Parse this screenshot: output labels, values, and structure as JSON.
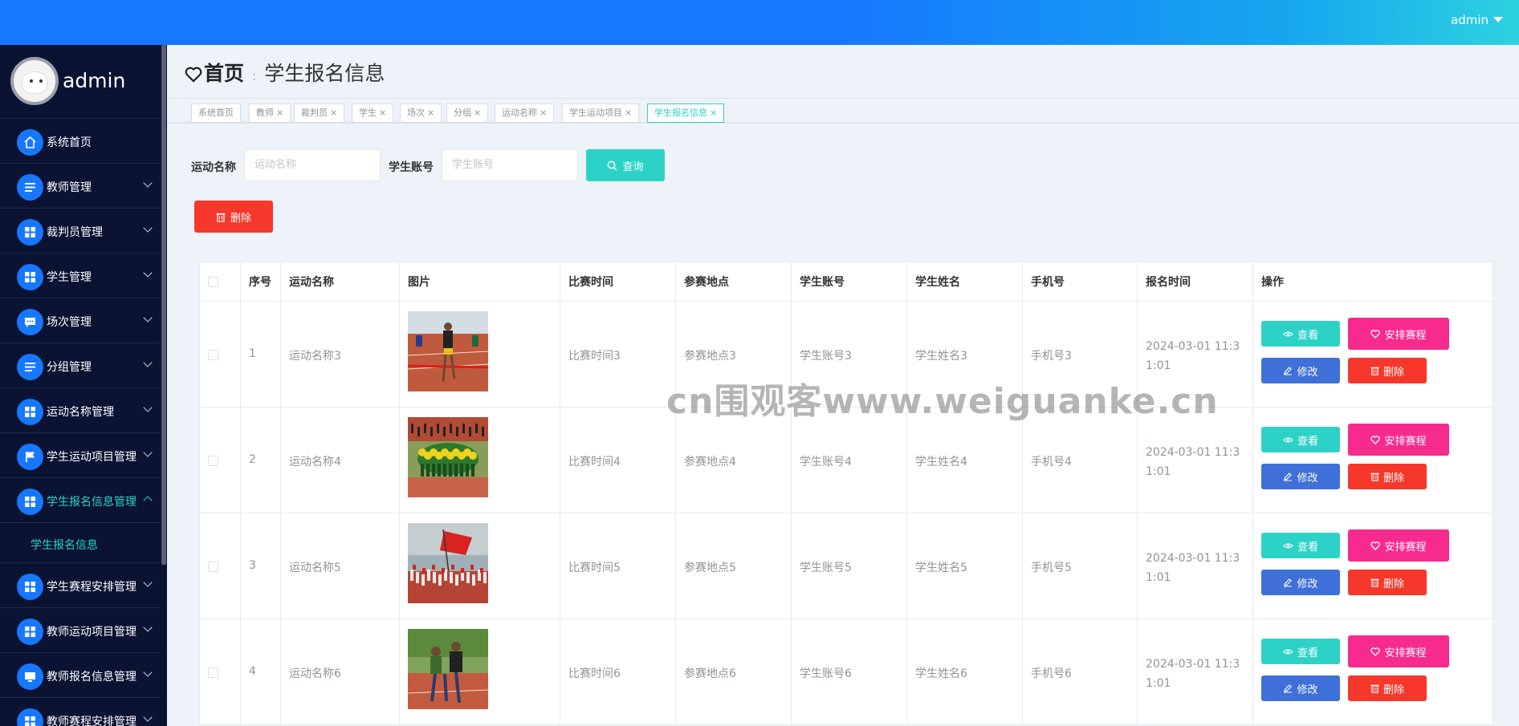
{
  "header": {
    "user": "admin"
  },
  "sidebar": {
    "profile_name": "admin",
    "items": [
      {
        "label": "系统首页",
        "icon": "home-icon",
        "has_chevron": false
      },
      {
        "label": "教师管理",
        "icon": "list-icon",
        "has_chevron": true
      },
      {
        "label": "裁判员管理",
        "icon": "grid-icon",
        "has_chevron": true
      },
      {
        "label": "学生管理",
        "icon": "grid-icon",
        "has_chevron": true
      },
      {
        "label": "场次管理",
        "icon": "chat-icon",
        "has_chevron": true
      },
      {
        "label": "分组管理",
        "icon": "list-icon",
        "has_chevron": true
      },
      {
        "label": "运动名称管理",
        "icon": "grid-icon",
        "has_chevron": true
      },
      {
        "label": "学生运动项目管理",
        "icon": "flag-icon",
        "has_chevron": true
      },
      {
        "label": "学生报名信息管理",
        "icon": "grid-icon",
        "has_chevron": true,
        "active": true
      },
      {
        "label": "学生赛程安排管理",
        "icon": "grid-icon",
        "has_chevron": true
      },
      {
        "label": "教师运动项目管理",
        "icon": "grid-icon",
        "has_chevron": true
      },
      {
        "label": "教师报名信息管理",
        "icon": "monitor-icon",
        "has_chevron": true
      },
      {
        "label": "教师赛程安排管理",
        "icon": "grid-icon",
        "has_chevron": true
      }
    ],
    "submenu_label": "学生报名信息"
  },
  "breadcrumb": {
    "home": "首页",
    "current": "学生报名信息"
  },
  "tabs": [
    {
      "label": "系统首页",
      "closable": false
    },
    {
      "label": "教师",
      "closable": true
    },
    {
      "label": "裁判员",
      "closable": true
    },
    {
      "label": "学生",
      "closable": true
    },
    {
      "label": "场次",
      "closable": true
    },
    {
      "label": "分组",
      "closable": true
    },
    {
      "label": "运动名称",
      "closable": true
    },
    {
      "label": "学生运动项目",
      "closable": true
    },
    {
      "label": "学生报名信息",
      "closable": true,
      "active": true
    }
  ],
  "search": {
    "sport_label": "运动名称",
    "sport_placeholder": "运动名称",
    "account_label": "学生账号",
    "account_placeholder": "学生账号",
    "query_button": "查询"
  },
  "actions": {
    "delete_button": "删除"
  },
  "table": {
    "headers": [
      "序号",
      "运动名称",
      "图片",
      "比赛时间",
      "参赛地点",
      "学生账号",
      "学生姓名",
      "手机号",
      "报名时间",
      "操作"
    ],
    "rows": [
      {
        "index": "1",
        "sport": "运动名称3",
        "time": "比赛时间3",
        "place": "参赛地点3",
        "account": "学生账号3",
        "name": "学生姓名3",
        "phone": "手机号3",
        "signup": "2024-03-01 11:31:01",
        "photo": "running-finish-photo"
      },
      {
        "index": "2",
        "sport": "运动名称4",
        "time": "比赛时间4",
        "place": "参赛地点4",
        "account": "学生账号4",
        "name": "学生姓名4",
        "phone": "手机号4",
        "signup": "2024-03-01 11:31:01",
        "photo": "parade-formation-photo"
      },
      {
        "index": "3",
        "sport": "运动名称5",
        "time": "比赛时间5",
        "place": "参赛地点5",
        "account": "学生账号5",
        "name": "学生姓名5",
        "phone": "手机号5",
        "signup": "2024-03-01 11:31:01",
        "photo": "flag-parade-photo"
      },
      {
        "index": "4",
        "sport": "运动名称6",
        "time": "比赛时间6",
        "place": "参赛地点6",
        "account": "学生账号6",
        "name": "学生姓名6",
        "phone": "手机号6",
        "signup": "2024-03-01 11:31:01",
        "photo": "three-legged-race-photo"
      }
    ],
    "row_buttons": {
      "view": "查看",
      "schedule": "安排赛程",
      "edit": "修改",
      "delete": "删除"
    }
  },
  "watermark": "cn围观客www.weiguanke.cn",
  "colors": {
    "primary": "#1677ff",
    "accent": "#2dd2c7",
    "danger": "#f5382b",
    "pink": "#f72a8d",
    "edit": "#3f6fd8",
    "sidebar_bg": "#0b1333"
  }
}
